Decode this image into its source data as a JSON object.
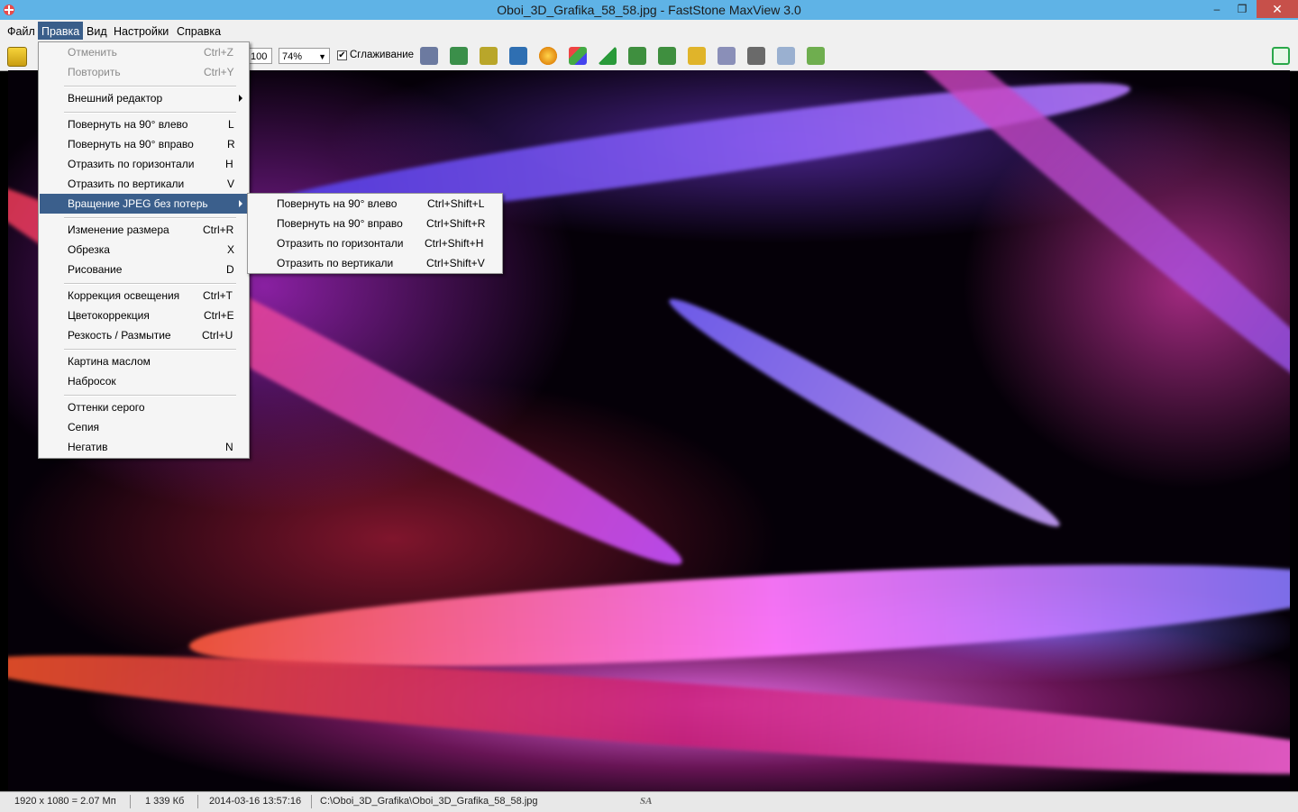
{
  "window": {
    "title": "Oboi_3D_Grafika_58_58.jpg - FastStone MaxView 3.0",
    "minimize": "–",
    "restore": "❐",
    "close": "✕"
  },
  "menubar": {
    "items": [
      "Файл",
      "Правка",
      "Вид",
      "Настройки",
      "Справка"
    ],
    "active": "Правка"
  },
  "toolbar": {
    "size_field": "100",
    "zoom_value": "74%",
    "smoothing_label": "Сглаживание",
    "smoothing_checked": true
  },
  "edit_menu": {
    "rows": [
      {
        "label": "Отменить",
        "key": "Ctrl+Z",
        "disabled": true
      },
      {
        "label": "Повторить",
        "key": "Ctrl+Y",
        "disabled": true
      },
      {
        "label": "Внешний редактор",
        "key": "",
        "submenu": true
      },
      {
        "label": "Повернуть на 90° влево",
        "key": "L"
      },
      {
        "label": "Повернуть на 90° вправо",
        "key": "R"
      },
      {
        "label": "Отразить по горизонтали",
        "key": "H"
      },
      {
        "label": "Отразить по вертикали",
        "key": "V"
      },
      {
        "label": "Вращение JPEG без потерь",
        "key": "",
        "submenu": true,
        "highlighted": true
      },
      {
        "label": "Изменение размера",
        "key": "Ctrl+R"
      },
      {
        "label": "Обрезка",
        "key": "X"
      },
      {
        "label": "Рисование",
        "key": "D"
      },
      {
        "label": "Коррекция освещения",
        "key": "Ctrl+T"
      },
      {
        "label": "Цветокоррекция",
        "key": "Ctrl+E"
      },
      {
        "label": "Резкость / Размытие",
        "key": "Ctrl+U"
      },
      {
        "label": "Картина маслом",
        "key": ""
      },
      {
        "label": "Набросок",
        "key": ""
      },
      {
        "label": "Оттенки серого",
        "key": ""
      },
      {
        "label": "Сепия",
        "key": ""
      },
      {
        "label": "Негатив",
        "key": "N"
      }
    ]
  },
  "jpeg_submenu": {
    "rows": [
      {
        "label": "Повернуть на 90° влево",
        "key": "Ctrl+Shift+L"
      },
      {
        "label": "Повернуть на 90° вправо",
        "key": "Ctrl+Shift+R"
      },
      {
        "label": "Отразить по горизонтали",
        "key": "Ctrl+Shift+H"
      },
      {
        "label": "Отразить по вертикали",
        "key": "Ctrl+Shift+V"
      }
    ]
  },
  "status": {
    "dimensions": "1920 x 1080 = 2.07 Мп",
    "filesize": "1 339 Кб",
    "datetime": "2014-03-16 13:57:16",
    "path": "C:\\Oboi_3D_Grafika\\Oboi_3D_Grafika_58_58.jpg",
    "watermark": "SA"
  }
}
